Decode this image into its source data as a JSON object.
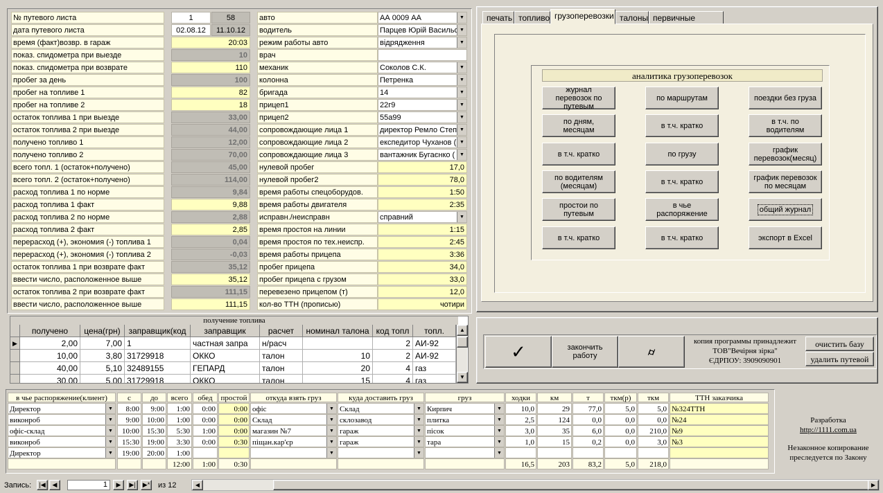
{
  "form": {
    "rows": [
      {
        "label": "№ путевого листа",
        "v1": "1",
        "v1type": "val",
        "v2": "58",
        "v2type": "valg"
      },
      {
        "label": "дата путевого листа",
        "v1": "02.08.12",
        "v1type": "val",
        "v2": "11.10.12",
        "v2type": "valg"
      },
      {
        "label": "время (факт)возвр. в гараж",
        "v": "20:03",
        "type": "valy"
      },
      {
        "label": "показ. спидометра при выезде",
        "v": "10",
        "type": "valg"
      },
      {
        "label": "показ. спидометра при возврате",
        "v": "110",
        "type": "valy"
      },
      {
        "label": "пробег за день",
        "v": "100",
        "type": "valg"
      },
      {
        "label": "пробег на топливе 1",
        "v": "82",
        "type": "valy"
      },
      {
        "label": "пробег на топливе 2",
        "v": "18",
        "type": "valy"
      },
      {
        "label": "остаток  топлива 1 при выезде",
        "v": "33,00",
        "type": "valg"
      },
      {
        "label": "остаток топлива 2 при выезде",
        "v": "44,00",
        "type": "valg"
      },
      {
        "label": "получено топливо 1",
        "v": "12,00",
        "type": "valg"
      },
      {
        "label": "получено топливо 2",
        "v": "70,00",
        "type": "valg"
      },
      {
        "label": "всего топл. 1 (остаток+получено)",
        "v": "45,00",
        "type": "valg"
      },
      {
        "label": "всего топл. 2 (остаток+получено)",
        "v": "114,00",
        "type": "valg"
      },
      {
        "label": "расход топлива 1 по норме",
        "v": "9,84",
        "type": "valg"
      },
      {
        "label": "расход топлива 1 факт",
        "v": "9,88",
        "type": "valy"
      },
      {
        "label": "расход топлива 2 по норме",
        "v": "2,88",
        "type": "valg"
      },
      {
        "label": "расход топлива 2 факт",
        "v": "2,85",
        "type": "valy"
      },
      {
        "label": "перерасход (+), экономия (-) топлива 1",
        "v": "0,04",
        "type": "valg"
      },
      {
        "label": "перерасход (+), экономия (-) топлива 2",
        "v": "-0,03",
        "type": "valg"
      },
      {
        "label": "остаток топлива 1 при возврате факт",
        "v": "35,12",
        "type": "valg"
      },
      {
        "label": "ввести число, расположенное выше",
        "v": "35,12",
        "type": "valy"
      },
      {
        "label": "остаток топлива 2 при возврате факт",
        "v": "111,15",
        "type": "valg"
      },
      {
        "label": "ввести число, расположенное выше",
        "v": "111,15",
        "type": "valy"
      }
    ],
    "right_rows": [
      {
        "label": "авто",
        "v": "АА 0009 АА",
        "kind": "combo"
      },
      {
        "label": "водитель",
        "v": "Парцев Юрій Васильо",
        "kind": "combo"
      },
      {
        "label": "режим работы авто",
        "v": "відрядження",
        "kind": "combo"
      },
      {
        "label": "врач",
        "v": "",
        "kind": "plain"
      },
      {
        "label": "механик",
        "v": "Соколов С.К.",
        "kind": "combo"
      },
      {
        "label": "колонна",
        "v": "Петренка",
        "kind": "combo"
      },
      {
        "label": "бригада",
        "v": "14",
        "kind": "combo"
      },
      {
        "label": "прицеп1",
        "v": "22г9",
        "kind": "combo"
      },
      {
        "label": "прицеп2",
        "v": "55а99",
        "kind": "combo"
      },
      {
        "label": "сопровождающие  лица 1",
        "v": "директор Ремло Степ",
        "kind": "combo"
      },
      {
        "label": "сопровождающие лица 2",
        "v": "експедитор Чуханов (",
        "kind": "combo"
      },
      {
        "label": "сопровождающие лица 3",
        "v": "вантажник Бугаєнко (",
        "kind": "combo"
      },
      {
        "label": "нулевой пробег",
        "v": "17,0",
        "kind": "rv"
      },
      {
        "label": "нулевой пробег2",
        "v": "78,0",
        "kind": "rv"
      },
      {
        "label": "время работы спецоборудов.",
        "v": "1:50",
        "kind": "rv"
      },
      {
        "label": "время работы двигателя",
        "v": "2:35",
        "kind": "rv"
      },
      {
        "label": "исправн./неисправн",
        "v": "справний",
        "kind": "combo"
      },
      {
        "label": "время простоя на линии",
        "v": "1:15",
        "kind": "rv"
      },
      {
        "label": "время простоя по тех.неиспр.",
        "v": "2:45",
        "kind": "rv"
      },
      {
        "label": "время работы прицепа",
        "v": "3:36",
        "kind": "rv"
      },
      {
        "label": "пробег прицепа",
        "v": "34,0",
        "kind": "rv"
      },
      {
        "label": "пробег прицепа с грузом",
        "v": "33,0",
        "kind": "rv"
      },
      {
        "label": "перевезено прицепом (т)",
        "v": "12,0",
        "kind": "rv"
      },
      {
        "label": "кол-во ТТН (прописью)",
        "v": "чотири",
        "kind": "rv"
      }
    ]
  },
  "fuel": {
    "title": "получение топлива",
    "headers": [
      "получено",
      "цена(грн)",
      "заправщик(код",
      "заправщик",
      "расчет",
      "номинал талона",
      "код топл",
      "топл."
    ],
    "rows": [
      [
        "2,00",
        "7,00",
        "1",
        "частная запра",
        "н/расч",
        "",
        "2",
        "АИ-92"
      ],
      [
        "10,00",
        "3,80",
        "31729918",
        "ОККО",
        "талон",
        "10",
        "2",
        "АИ-92"
      ],
      [
        "40,00",
        "5,10",
        "32489155",
        "ГЕПАРД",
        "талон",
        "20",
        "4",
        "газ"
      ],
      [
        "30,00",
        "5,00",
        "31729918",
        "ОККО",
        "талон",
        "15",
        "4",
        "газ"
      ]
    ]
  },
  "tabs": [
    "печать",
    "топливо",
    "грузоперевозки",
    "талоны",
    "первичные данные"
  ],
  "analytics": {
    "title": "аналитика грузоперевозок",
    "buttons": [
      [
        "журнал перевозок по путевым",
        "по маршрутам",
        "поездки без груза"
      ],
      [
        "по дням, месяцам",
        "в т.ч. кратко",
        "в т.ч. по водителям"
      ],
      [
        "в т.ч. кратко",
        "по грузу",
        "график перевозок(месяц)"
      ],
      [
        "по водителям (месяцам)",
        "в т.ч. кратко",
        "график перевозок по месяцам"
      ],
      [
        "простои по путевым",
        "в чье распоряжение",
        "общий журнал"
      ],
      [
        "в т.ч. кратко",
        "в т.ч. кратко",
        "экспорт в Excel"
      ]
    ]
  },
  "actions": {
    "finish": "закончить работу",
    "owner_line1": "копия программы принадлежит",
    "owner_line2": "ТОВ\"Вечірня зірка\"",
    "owner_line3": "ЄДРПОУ: 3909090901",
    "clear_db": "очистить базу",
    "delete_sheet": "удалить путевой"
  },
  "cargo": {
    "headers": [
      "в чье распоряжение(клиент)",
      "с",
      "до",
      "всего",
      "обед",
      "простой",
      "откуда взять груз",
      "куда доставить груз",
      "груз",
      "ходки",
      "км",
      "т",
      "ткм(р)",
      "ткм",
      "ТТН заказчика"
    ],
    "rows": [
      [
        "Директор",
        "8:00",
        "9:00",
        "1:00",
        "0:00",
        "0:00",
        "офіс",
        "Склад",
        "Кирпич",
        "10,0",
        "29",
        "77,0",
        "5,0",
        "5,0",
        "№324ТТН"
      ],
      [
        "виконроб",
        "9:00",
        "10:00",
        "1:00",
        "0:00",
        "0:00",
        "Склад",
        "склозавод",
        "плитка",
        "2,5",
        "124",
        "0,0",
        "0,0",
        "0,0",
        "№24"
      ],
      [
        "офіс-склад",
        "10:00",
        "15:30",
        "5:30",
        "1:00",
        "0:00",
        "магазин №7",
        "гараж",
        "пісок",
        "3,0",
        "35",
        "6,0",
        "0,0",
        "210,0",
        "№9"
      ],
      [
        "виконроб",
        "15:30",
        "19:00",
        "3:30",
        "0:00",
        "0:30",
        "піщан.кар'єр",
        "гараж",
        "тара",
        "1,0",
        "15",
        "0,2",
        "0,0",
        "3,0",
        "№3"
      ],
      [
        "Директор",
        "19:00",
        "20:00",
        "1:00",
        "",
        "",
        "",
        "",
        "",
        "",
        "",
        "",
        "",
        "",
        ""
      ]
    ],
    "totals": [
      "",
      "",
      "",
      "12:00",
      "1:00",
      "0:30",
      "",
      "",
      "",
      "16,5",
      "203",
      "83,2",
      "5,0",
      "218,0",
      ""
    ]
  },
  "dev": {
    "line1": "Разработка",
    "link": "http://1111.com.ua",
    "line3": "Незаконное копирование",
    "line4": "преследуется по Закону"
  },
  "nav": {
    "label": "Запись:",
    "current": "1",
    "of": "из  12"
  }
}
